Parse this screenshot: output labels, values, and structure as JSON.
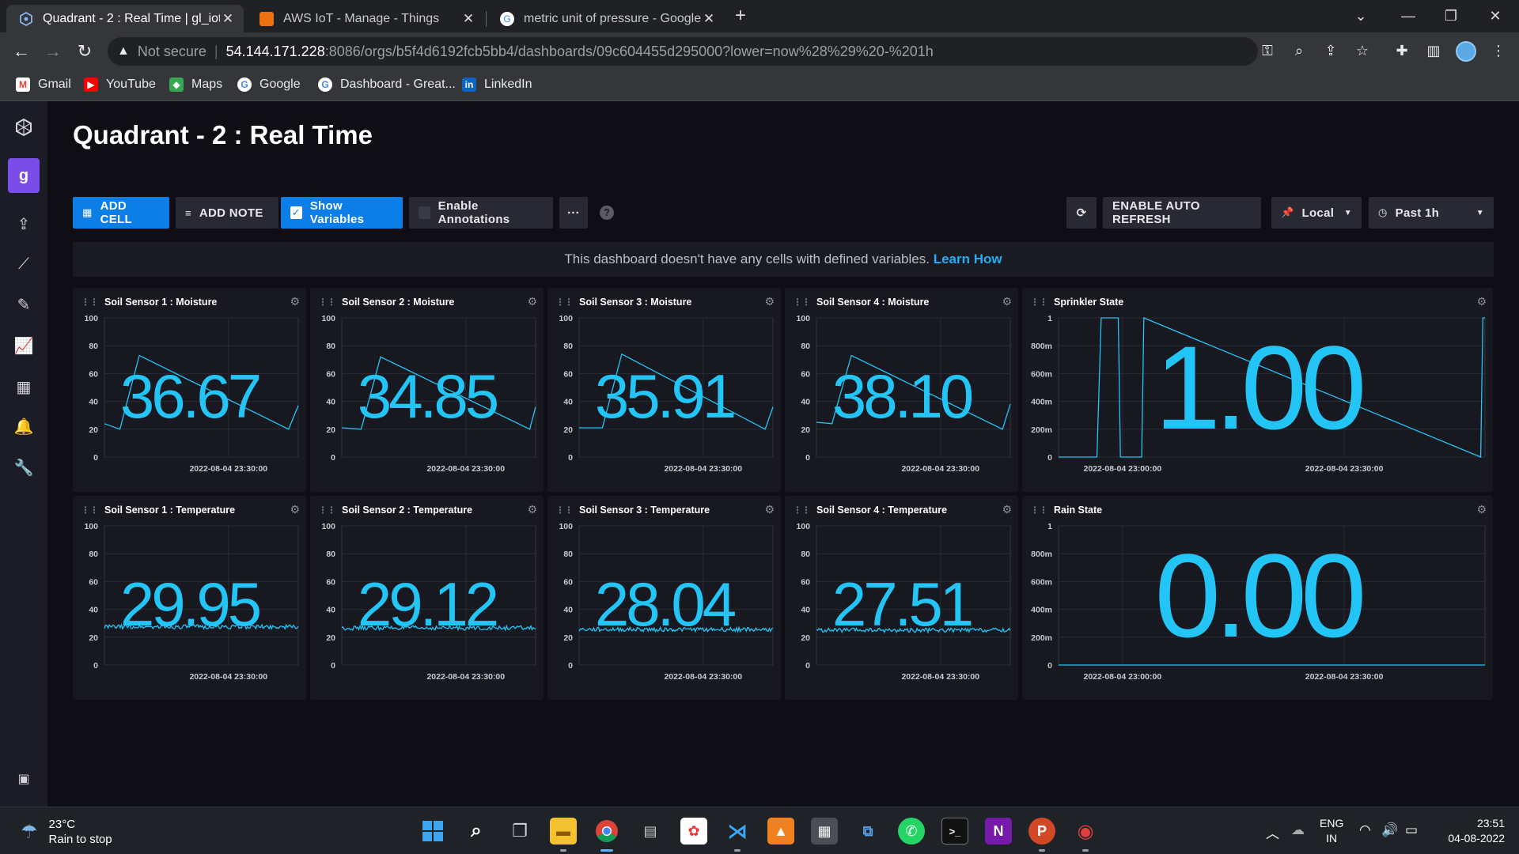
{
  "browser": {
    "tabs": [
      {
        "title": "Quadrant - 2 : Real Time | gl_iot_",
        "favicon": "influx-icon",
        "active": true
      },
      {
        "title": "AWS IoT - Manage - Things",
        "favicon": "aws-icon",
        "active": false
      },
      {
        "title": "metric unit of pressure - Google",
        "favicon": "google-icon",
        "active": false
      }
    ],
    "address": {
      "security_label": "Not secure",
      "host": "54.144.171.228",
      "path": ":8086/orgs/b5f4d6192fcb5bb4/dashboards/09c604455d295000?lower=now%28%29%20-%201h"
    },
    "bookmarks": [
      {
        "label": "Gmail",
        "icon": "gmail-icon",
        "color": "#ea4335"
      },
      {
        "label": "YouTube",
        "icon": "youtube-icon",
        "color": "#ff0000"
      },
      {
        "label": "Maps",
        "icon": "maps-icon",
        "color": "#34a853"
      },
      {
        "label": "Google",
        "icon": "google-icon",
        "color": "#4285f4"
      },
      {
        "label": "Dashboard - Great...",
        "icon": "google-icon",
        "color": "#4285f4"
      },
      {
        "label": "LinkedIn",
        "icon": "linkedin-icon",
        "color": "#0a66c2"
      }
    ]
  },
  "app": {
    "org_initial": "g",
    "dashboard_title": "Quadrant - 2 : Real Time",
    "buttons": {
      "add_cell": "ADD CELL",
      "add_note": "ADD NOTE",
      "show_variables": "Show Variables",
      "enable_annotations": "Enable Annotations",
      "more": "···",
      "help": "?",
      "auto_refresh": "ENABLE AUTO REFRESH",
      "timezone": "Local",
      "time_range": "Past 1h"
    },
    "variables_notice": "This dashboard doesn't have any cells with defined variables.",
    "variables_link": "Learn How",
    "accent_color": "#22c5f5"
  },
  "chart_data": [
    {
      "type": "line",
      "title": "Soil Sensor 1 : Moisture",
      "ylim": [
        0,
        100
      ],
      "yticks": [
        "0",
        "20",
        "40",
        "60",
        "80",
        "100"
      ],
      "xtick": "2022-08-04 23:30:00",
      "big_value": "36.67",
      "x": [
        0,
        0.08,
        0.18,
        0.95,
        1.0
      ],
      "values": [
        24,
        20,
        73,
        20,
        37
      ]
    },
    {
      "type": "line",
      "title": "Soil Sensor 2 : Moisture",
      "ylim": [
        0,
        100
      ],
      "yticks": [
        "0",
        "20",
        "40",
        "60",
        "80",
        "100"
      ],
      "xtick": "2022-08-04 23:30:00",
      "big_value": "34.85",
      "x": [
        0,
        0.1,
        0.2,
        0.97,
        1.0
      ],
      "values": [
        21,
        20,
        72,
        20,
        36
      ]
    },
    {
      "type": "line",
      "title": "Soil Sensor 3 : Moisture",
      "ylim": [
        0,
        100
      ],
      "yticks": [
        "0",
        "20",
        "40",
        "60",
        "80",
        "100"
      ],
      "xtick": "2022-08-04 23:30:00",
      "big_value": "35.91",
      "x": [
        0,
        0.12,
        0.22,
        0.96,
        1.0
      ],
      "values": [
        21,
        21,
        74,
        20,
        36
      ]
    },
    {
      "type": "line",
      "title": "Soil Sensor 4 : Moisture",
      "ylim": [
        0,
        100
      ],
      "yticks": [
        "0",
        "20",
        "40",
        "60",
        "80",
        "100"
      ],
      "xtick": "2022-08-04 23:30:00",
      "big_value": "38.10",
      "x": [
        0,
        0.08,
        0.18,
        0.96,
        1.0
      ],
      "values": [
        25,
        24,
        73,
        20,
        38
      ]
    },
    {
      "type": "line",
      "title": "Sprinkler State",
      "ylim": [
        0,
        1
      ],
      "yticks": [
        "0",
        "200m",
        "400m",
        "600m",
        "800m",
        "1"
      ],
      "xticks": [
        "2022-08-04 23:00:00",
        "2022-08-04 23:30:00"
      ],
      "big_value": "1.00",
      "step": true,
      "x": [
        0,
        0.09,
        0.1,
        0.14,
        0.145,
        0.195,
        0.2,
        0.99,
        0.995,
        1.0
      ],
      "values": [
        0,
        0,
        1,
        1,
        0,
        0,
        1,
        0,
        1,
        1
      ]
    },
    {
      "type": "line",
      "title": "Soil Sensor 1 : Temperature",
      "ylim": [
        0,
        100
      ],
      "yticks": [
        "0",
        "20",
        "40",
        "60",
        "80",
        "100"
      ],
      "xtick": "2022-08-04 23:30:00",
      "big_value": "29.95",
      "noisy_level": 29.95
    },
    {
      "type": "line",
      "title": "Soil Sensor 2 : Temperature",
      "ylim": [
        0,
        100
      ],
      "yticks": [
        "0",
        "20",
        "40",
        "60",
        "80",
        "100"
      ],
      "xtick": "2022-08-04 23:30:00",
      "big_value": "29.12",
      "noisy_level": 29.12
    },
    {
      "type": "line",
      "title": "Soil Sensor 3 : Temperature",
      "ylim": [
        0,
        100
      ],
      "yticks": [
        "0",
        "20",
        "40",
        "60",
        "80",
        "100"
      ],
      "xtick": "2022-08-04 23:30:00",
      "big_value": "28.04",
      "noisy_level": 28.04
    },
    {
      "type": "line",
      "title": "Soil Sensor 4 : Temperature",
      "ylim": [
        0,
        100
      ],
      "yticks": [
        "0",
        "20",
        "40",
        "60",
        "80",
        "100"
      ],
      "xtick": "2022-08-04 23:30:00",
      "big_value": "27.51",
      "noisy_level": 27.51
    },
    {
      "type": "line",
      "title": "Rain State",
      "ylim": [
        0,
        1
      ],
      "yticks": [
        "0",
        "200m",
        "400m",
        "600m",
        "800m",
        "1"
      ],
      "xticks": [
        "2022-08-04 23:00:00",
        "2022-08-04 23:30:00"
      ],
      "big_value": "0.00",
      "x": [
        0,
        1
      ],
      "values": [
        0,
        0
      ]
    }
  ],
  "taskbar": {
    "weather_temp": "23°C",
    "weather_desc": "Rain to stop",
    "lang_1": "ENG",
    "lang_2": "IN",
    "time": "23:51",
    "date": "04-08-2022"
  }
}
